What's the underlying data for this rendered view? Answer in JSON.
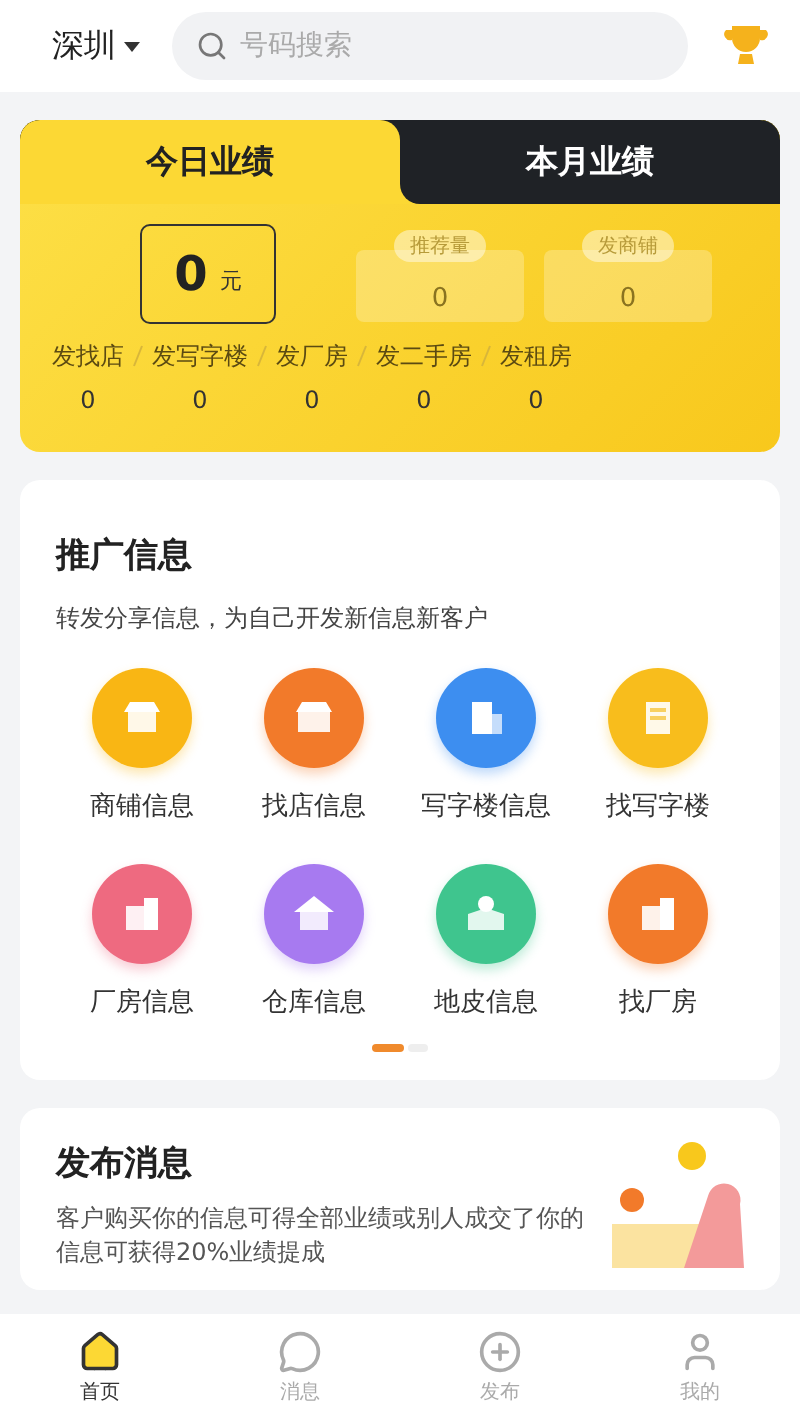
{
  "header": {
    "city": "深圳",
    "search": {
      "placeholder": "号码搜索"
    }
  },
  "performance": {
    "tabs": [
      {
        "label": "今日业绩",
        "selected": true
      },
      {
        "label": "本月业绩",
        "selected": false
      }
    ],
    "amount": {
      "value": "0",
      "unit": "元"
    },
    "stats": [
      {
        "label": "推荐量",
        "value": "0"
      },
      {
        "label": "发商铺",
        "value": "0"
      }
    ],
    "counts": [
      {
        "label": "发找店",
        "value": "0"
      },
      {
        "label": "发写字楼",
        "value": "0"
      },
      {
        "label": "发厂房",
        "value": "0"
      },
      {
        "label": "发二手房",
        "value": "0"
      },
      {
        "label": "发租房",
        "value": "0"
      }
    ]
  },
  "promo": {
    "title": "推广信息",
    "subtitle": "转发分享信息，为自己开发新信息新客户",
    "items": [
      {
        "label": "商铺信息",
        "color": "#f9b614",
        "kind": "shop"
      },
      {
        "label": "找店信息",
        "color": "#f27a2a",
        "kind": "box"
      },
      {
        "label": "写字楼信息",
        "color": "#3d8ef0",
        "kind": "office"
      },
      {
        "label": "找写字楼",
        "color": "#f8bd1c",
        "kind": "building"
      },
      {
        "label": "厂房信息",
        "color": "#ee6a80",
        "kind": "factory"
      },
      {
        "label": "仓库信息",
        "color": "#a77af0",
        "kind": "warehouse"
      },
      {
        "label": "地皮信息",
        "color": "#3fc58e",
        "kind": "map"
      },
      {
        "label": "找厂房",
        "color": "#f27a2a",
        "kind": "factory"
      }
    ],
    "pager": [
      {
        "selected": true
      },
      {
        "selected": false
      }
    ]
  },
  "publish": {
    "title": "发布消息",
    "text": "客户购买你的信息可得全部业绩或别人成交了你的信息可获得20%业绩提成"
  },
  "nav": [
    {
      "label": "首页",
      "selected": true,
      "kind": "home"
    },
    {
      "label": "消息",
      "selected": false,
      "kind": "chat"
    },
    {
      "label": "发布",
      "selected": false,
      "kind": "publish"
    },
    {
      "label": "我的",
      "selected": false,
      "kind": "user"
    }
  ]
}
